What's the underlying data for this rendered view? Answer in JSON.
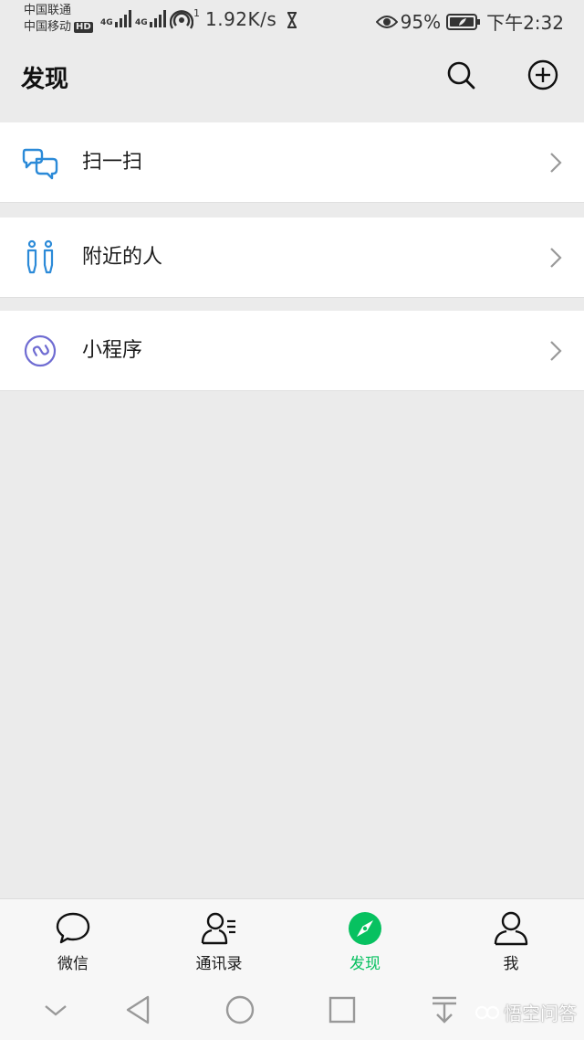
{
  "status_bar": {
    "carrier1": "中国联通",
    "carrier2": "中国移动",
    "hd": "HD",
    "net1": "4G",
    "net2": "4G",
    "hotspot_num": "1",
    "speed": "1.92K/s",
    "battery": "95%",
    "time": "下午2:32"
  },
  "header": {
    "title": "发现"
  },
  "menu": {
    "items": [
      {
        "label": "扫一扫"
      },
      {
        "label": "附近的人"
      },
      {
        "label": "小程序"
      }
    ]
  },
  "tabbar": {
    "tabs": [
      {
        "label": "微信"
      },
      {
        "label": "通讯录"
      },
      {
        "label": "发现"
      },
      {
        "label": "我"
      }
    ],
    "active_color": "#07c160"
  },
  "watermark": {
    "text": "悟空问答"
  },
  "colors": {
    "background": "#ebebeb",
    "accent": "#07c160",
    "scan_icon": "#2b8ad8",
    "nearby_icon": "#2b8ad8",
    "miniprogram_icon": "#6f6cd2"
  }
}
